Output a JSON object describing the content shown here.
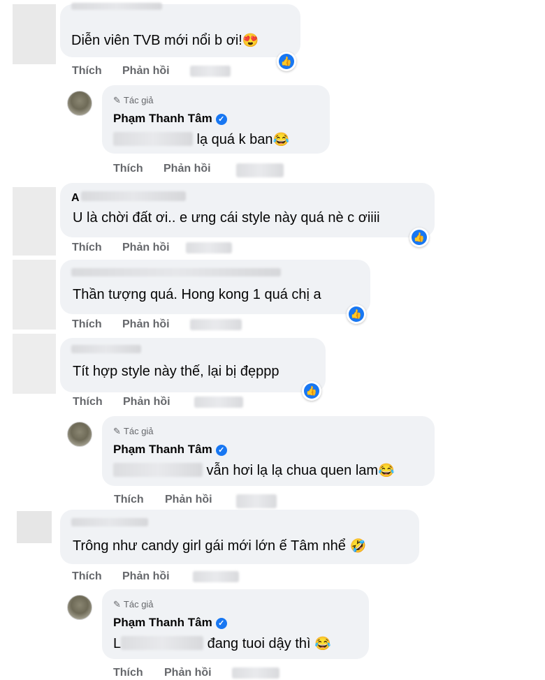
{
  "actions": {
    "like": "Thích",
    "reply": "Phản hồi"
  },
  "author_badge": "Tác giả",
  "author_name": "Phạm Thanh Tâm",
  "icons": {
    "like": "thumbs-up-icon",
    "pen": "pencil-icon",
    "verified": "verified-check-icon",
    "author_avatar": "avatar"
  },
  "comments": [
    {
      "text": "Diễn viên TVB mới nổi b ơi!",
      "emoji": "😍"
    },
    {
      "text": " lạ quá k ban",
      "emoji": "😂"
    },
    {
      "name": "A",
      "text": "U là chời đất ơi.. e ưng cái style này quá nè c ơiiii"
    },
    {
      "text": "Thần tượng quá. Hong kong 1 quá chị a"
    },
    {
      "text": "Tít hợp style này thế, lại bị đẹppp"
    },
    {
      "text": " vẫn hơi lạ lạ chua quen lam",
      "emoji": "😂"
    },
    {
      "text": "Trông như candy girl gái mới lớn ế Tâm nhể",
      "emoji": "🤣"
    },
    {
      "prefix": "L",
      "text": " đang tuoi dậy thì ",
      "emoji": "😂"
    }
  ],
  "colors": {
    "bubble": "#f0f2f5",
    "action": "#65676b",
    "like_blue": "#1877f2"
  }
}
